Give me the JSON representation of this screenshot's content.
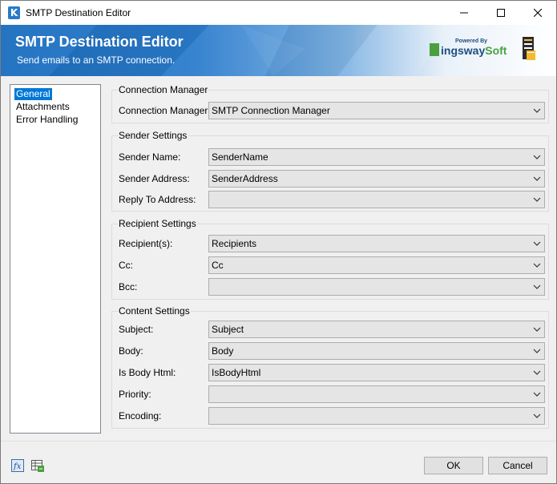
{
  "window": {
    "title": "SMTP Destination Editor"
  },
  "banner": {
    "title": "SMTP Destination Editor",
    "subtitle": "Send emails to an SMTP connection.",
    "brand_powered": "Powered By",
    "brand_name_prefix": "ingsway",
    "brand_name_suffix": "Soft"
  },
  "nav": {
    "items": [
      {
        "label": "General",
        "selected": true
      },
      {
        "label": "Attachments",
        "selected": false
      },
      {
        "label": "Error Handling",
        "selected": false
      }
    ]
  },
  "connection_manager": {
    "title": "Connection Manager",
    "label": "Connection Manager:",
    "value": "SMTP Connection Manager"
  },
  "sender": {
    "title": "Sender Settings",
    "name_label": "Sender Name:",
    "name_value": "SenderName",
    "address_label": "Sender Address:",
    "address_value": "SenderAddress",
    "reply_label": "Reply To Address:",
    "reply_value": ""
  },
  "recipient": {
    "title": "Recipient Settings",
    "to_label": "Recipient(s):",
    "to_value": "Recipients",
    "cc_label": "Cc:",
    "cc_value": "Cc",
    "bcc_label": "Bcc:",
    "bcc_value": ""
  },
  "content": {
    "title": "Content Settings",
    "subject_label": "Subject:",
    "subject_value": "Subject",
    "body_label": "Body:",
    "body_value": "Body",
    "is_html_label": "Is Body Html:",
    "is_html_value": "IsBodyHtml",
    "priority_label": "Priority:",
    "priority_value": "",
    "encoding_label": "Encoding:",
    "encoding_value": ""
  },
  "footer": {
    "ok_label": "OK",
    "cancel_label": "Cancel"
  },
  "colors": {
    "accent": "#0078d7",
    "banner_blue": "#1d6fbf",
    "brand_green": "#4aa03f",
    "brand_navy": "#1e4f7f"
  },
  "icons": {
    "app": "kingswaysoft-k-icon",
    "expression": "fx-icon",
    "variables": "variables-grid-icon",
    "banner": "document-stack-icon"
  }
}
